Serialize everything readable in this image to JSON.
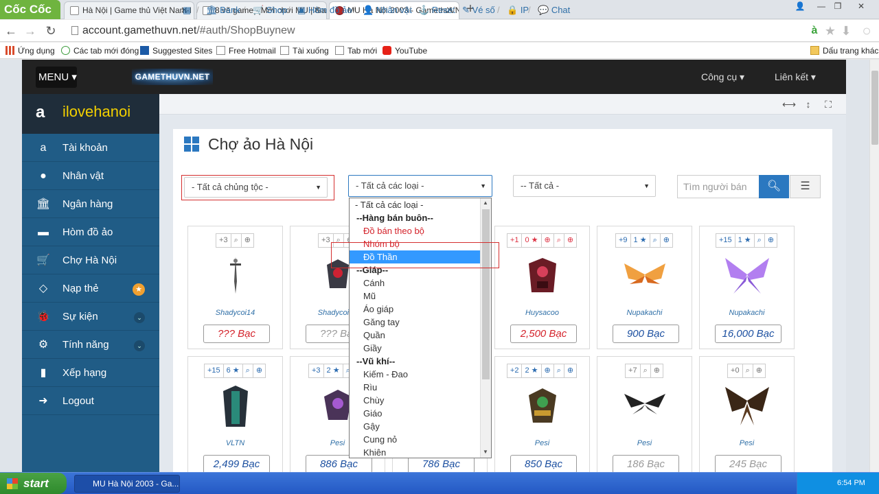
{
  "browser": {
    "logo": "Cốc Cốc",
    "tabs": [
      {
        "title": "Hà Nội | Game thủ Việt Nam-I"
      },
      {
        "title": "8 vẽ game - Mới chơi MU | Ga"
      },
      {
        "title": "MU Hà Nội 2003 - GamethuVN"
      }
    ],
    "new_tab": "+",
    "url_host": "account.gamethuvn.net",
    "url_path": "/#auth/ShopBuynew",
    "bookmarks": [
      "Ứng dụng",
      "Các tab mới đóng",
      "Suggested Sites",
      "Free Hotmail",
      "Tài xuống",
      "Tab mới",
      "YouTube"
    ],
    "other_bookmarks": "Dấu trang khác"
  },
  "topnav": {
    "menu": "MENU ▾",
    "logo": "GAMETHUVN.NET",
    "tools": "Công cụ ▾",
    "links": "Liên kết ▾"
  },
  "sidebar": {
    "username": "ilovehanoi",
    "items": [
      {
        "label": "Tài khoản",
        "icon": "a"
      },
      {
        "label": "Nhân vật",
        "icon": "●"
      },
      {
        "label": "Ngân hàng",
        "icon": "🏛"
      },
      {
        "label": "Hòm đồ ảo",
        "icon": "▬"
      },
      {
        "label": "Chợ Hà Nội",
        "icon": "🛒"
      },
      {
        "label": "Nạp thẻ",
        "icon": "◇",
        "badge": "★"
      },
      {
        "label": "Sự kiện",
        "icon": "🐞",
        "chevron": "⌄"
      },
      {
        "label": "Tính năng",
        "icon": "⚙",
        "chevron": "⌄"
      },
      {
        "label": "Xếp hạng",
        "icon": "▮"
      },
      {
        "label": "Logout",
        "icon": "➜"
      }
    ]
  },
  "breadcrumb": [
    "Bank",
    "Shop",
    "Hòm đồ ảo",
    "Nhân vật",
    "Reset",
    "Vé số",
    "IP",
    "Chat"
  ],
  "page": {
    "title": "Chợ ảo Hà Nội",
    "filter_race": "- Tất cả chủng tộc -",
    "filter_type": "- Tất cả các loại -",
    "filter_all": "-- Tất cả -",
    "search_placeholder": "Tìm người bán"
  },
  "dropdown": {
    "options": [
      {
        "label": "- Tất cả các loại -",
        "kind": "first"
      },
      {
        "label": "--Hàng bán buôn--",
        "kind": "group"
      },
      {
        "label": "Đồ bán theo bộ",
        "kind": "red"
      },
      {
        "label": "Nhóm bộ",
        "kind": "red"
      },
      {
        "label": "Đồ Thần",
        "kind": "selected"
      },
      {
        "label": "--Giáp--",
        "kind": "group"
      },
      {
        "label": "Cánh",
        "kind": "item"
      },
      {
        "label": "Mũ",
        "kind": "item"
      },
      {
        "label": "Áo giáp",
        "kind": "item"
      },
      {
        "label": "Găng tay",
        "kind": "item"
      },
      {
        "label": "Quần",
        "kind": "item"
      },
      {
        "label": "Giầy",
        "kind": "item"
      },
      {
        "label": "--Vũ khí--",
        "kind": "group"
      },
      {
        "label": "Kiếm - Đao",
        "kind": "item"
      },
      {
        "label": "Rìu",
        "kind": "item"
      },
      {
        "label": "Chùy",
        "kind": "item"
      },
      {
        "label": "Giáo",
        "kind": "item"
      },
      {
        "label": "Gậy",
        "kind": "item"
      },
      {
        "label": "Cung nỏ",
        "kind": "item"
      },
      {
        "label": "Khiên",
        "kind": "item"
      }
    ]
  },
  "items": [
    {
      "level": "+3",
      "stars": "",
      "seller": "Shadycoi14",
      "price": "??? Bạc",
      "price_style": "red",
      "art": "sword"
    },
    {
      "level": "+3",
      "stars": "",
      "seller": "Shadycoi14",
      "price": "??? Bạc",
      "price_style": "gray",
      "art": "armor"
    },
    {
      "level": "",
      "stars": "",
      "seller": "",
      "price": "",
      "price_style": "",
      "art": ""
    },
    {
      "level": "+1",
      "stars": "0",
      "seller": "Huysacoo",
      "price": "2,500 Bạc",
      "price_style": "red",
      "art": "armor-red"
    },
    {
      "level": "+9",
      "stars": "1",
      "seller": "Nupakachi",
      "price": "900 Bạc",
      "price_style": "blue",
      "art": "wings-orange"
    },
    {
      "level": "+15",
      "stars": "1",
      "seller": "Nupakachi",
      "price": "16,000 Bạc",
      "price_style": "blue",
      "art": "wings-purple"
    },
    {
      "level": "+15",
      "stars": "6",
      "seller": "VLTN",
      "price": "2,499 Bạc",
      "price_style": "blue",
      "art": "armor-green"
    },
    {
      "level": "+3",
      "stars": "2",
      "seller": "Pesi",
      "price": "886 Bạc",
      "price_style": "blue",
      "art": "armor-purple"
    },
    {
      "level": "",
      "stars": "",
      "seller": "",
      "price": "786 Bạc",
      "price_style": "blue",
      "art": ""
    },
    {
      "level": "+2",
      "stars": "2",
      "seller": "Pesi",
      "price": "850 Bạc",
      "price_style": "blue",
      "art": "armor-gold"
    },
    {
      "level": "+7",
      "stars": "",
      "seller": "Pesi",
      "price": "186 Bạc",
      "price_style": "gray",
      "art": "wings-dark"
    },
    {
      "level": "+0",
      "stars": "",
      "seller": "Pesi",
      "price": "245 Bạc",
      "price_style": "gray",
      "art": "wings-brown"
    }
  ],
  "taskbar": {
    "start": "start",
    "task": "MU Hà Nội 2003 - Ga...",
    "clock": "6:54 PM"
  },
  "colors": {
    "accent": "#2b78c0",
    "sidebar": "#205c86",
    "username": "#f3d000",
    "price_red": "#d4222a",
    "highlight": "#d42d2d"
  }
}
